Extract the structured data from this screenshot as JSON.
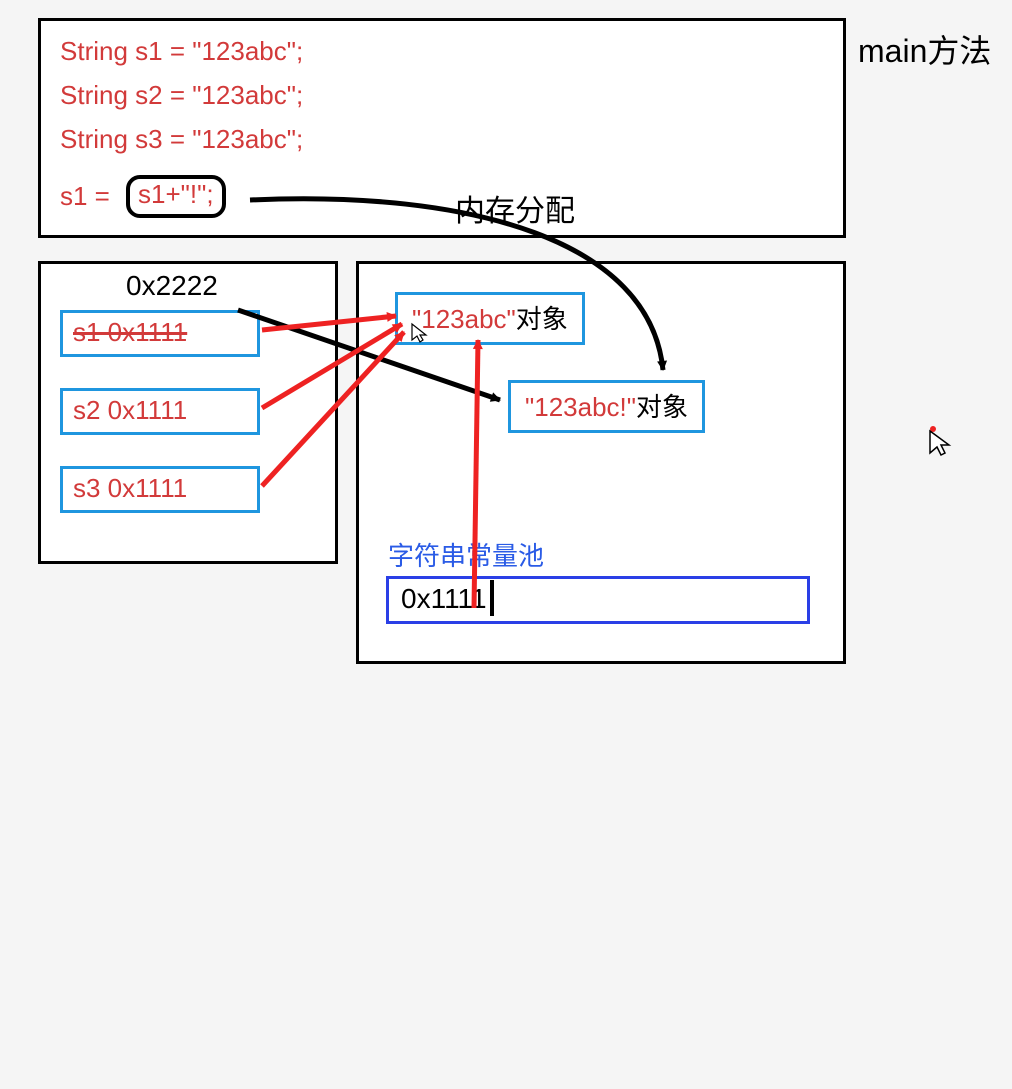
{
  "labels": {
    "main": "main方法",
    "mem": "内存分配",
    "pool": "字符串常量池",
    "newaddr": "0x2222",
    "pooladdr": "0x1111"
  },
  "code": {
    "l1": "String s1 = \"123abc\";",
    "l2": "String s2 = \"123abc\";",
    "l3": "String s3 = \"123abc\";",
    "l4a": "s1 =",
    "l4b": "s1+\"!\";"
  },
  "vars": {
    "s1": "s1  0x1111",
    "s2": "s2  0x1111",
    "s3": "s3  0x1111"
  },
  "objs": {
    "a": {
      "lit": "\"123abc\"",
      "suf": "对象"
    },
    "b": {
      "lit": "\"123abc!\"",
      "suf": "对象"
    }
  }
}
